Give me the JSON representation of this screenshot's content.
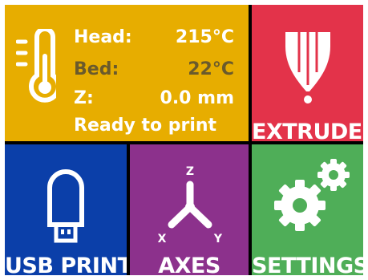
{
  "status": {
    "head_label": "Head:",
    "head_value": "215°C",
    "bed_label": "Bed:",
    "bed_value": "22°C",
    "z_label": "Z:",
    "z_value": "0.0 mm",
    "message": "Ready to print",
    "icon": "thermometer-icon"
  },
  "tiles": {
    "extruder": {
      "label": "EXTRUDER",
      "icon": "nozzle-icon"
    },
    "usb_print": {
      "label": "USB PRINT",
      "icon": "usb-drive-icon"
    },
    "axes": {
      "label": "AXES",
      "icon": "axes-icon",
      "axis_x": "X",
      "axis_y": "Y",
      "axis_z": "Z"
    },
    "settings": {
      "label": "SETTINGS",
      "icon": "gears-icon"
    }
  },
  "colors": {
    "status": "#e7ad00",
    "extruder": "#e3334a",
    "usb_print": "#0b3fa9",
    "axes": "#8c318c",
    "settings": "#4fae58",
    "bed_text": "#6a5a2c"
  }
}
